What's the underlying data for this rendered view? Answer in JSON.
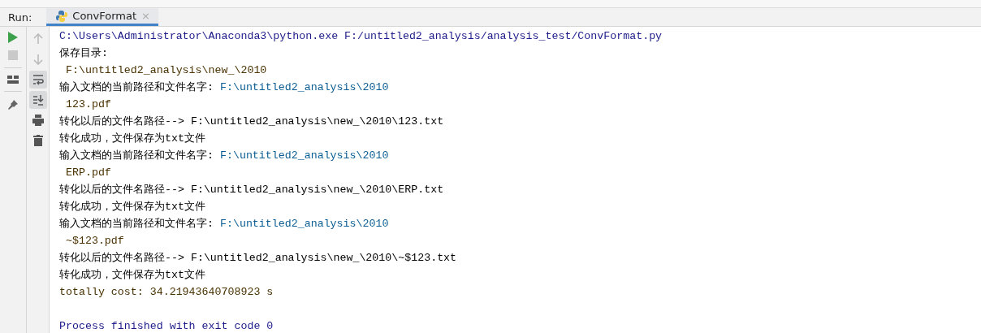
{
  "run_bar": {
    "label": "Run:",
    "tabs": [
      {
        "title": "ConvFormat",
        "selected": true,
        "close": "×"
      }
    ]
  },
  "left_toolbar": [
    {
      "kind": "run"
    },
    {
      "kind": "stop",
      "disabled": true
    },
    {
      "kind": "sep"
    },
    {
      "kind": "layout"
    },
    {
      "kind": "sep"
    },
    {
      "kind": "pin"
    }
  ],
  "console_toolbar": [
    {
      "kind": "up",
      "on": false
    },
    {
      "kind": "down",
      "on": false
    },
    {
      "kind": "wrap",
      "on": true
    },
    {
      "kind": "scroll",
      "on": true
    },
    {
      "kind": "print",
      "on": false
    },
    {
      "kind": "trash",
      "on": false
    }
  ],
  "console_lines": [
    [
      {
        "kind": "system",
        "text": "C:\\Users\\Administrator\\Anaconda3\\python.exe F:/untitled2_analysis/analysis_test/ConvFormat.py"
      }
    ],
    [
      {
        "kind": "output",
        "text": "保存目录:"
      }
    ],
    [
      {
        "kind": "echo",
        "text": " F:\\untitled2_analysis\\new_\\2010"
      }
    ],
    [
      {
        "kind": "output",
        "text": "输入文档的当前路径和文件名字: "
      },
      {
        "kind": "input",
        "text": "F:\\untitled2_analysis\\2010"
      }
    ],
    [
      {
        "kind": "echo",
        "text": " 123.pdf"
      }
    ],
    [
      {
        "kind": "output",
        "text": "转化以后的文件名路径--> F:\\untitled2_analysis\\new_\\2010\\123.txt"
      }
    ],
    [
      {
        "kind": "output",
        "text": "转化成功，文件保存为txt文件"
      }
    ],
    [
      {
        "kind": "output",
        "text": "输入文档的当前路径和文件名字: "
      },
      {
        "kind": "input",
        "text": "F:\\untitled2_analysis\\2010"
      }
    ],
    [
      {
        "kind": "echo",
        "text": " ERP.pdf"
      }
    ],
    [
      {
        "kind": "output",
        "text": "转化以后的文件名路径--> F:\\untitled2_analysis\\new_\\2010\\ERP.txt"
      }
    ],
    [
      {
        "kind": "output",
        "text": "转化成功，文件保存为txt文件"
      }
    ],
    [
      {
        "kind": "output",
        "text": "输入文档的当前路径和文件名字: "
      },
      {
        "kind": "input",
        "text": "F:\\untitled2_analysis\\2010"
      }
    ],
    [
      {
        "kind": "echo",
        "text": " ~$123.pdf"
      }
    ],
    [
      {
        "kind": "output",
        "text": "转化以后的文件名路径--> F:\\untitled2_analysis\\new_\\2010\\~$123.txt"
      }
    ],
    [
      {
        "kind": "output",
        "text": "转化成功，文件保存为txt文件"
      }
    ],
    [
      {
        "kind": "echo",
        "text": "totally cost: 34.21943640708923 s"
      }
    ],
    {
      "blank_before": true,
      "segments": [
        {
          "kind": "system",
          "text": "Process finished with exit code 0"
        }
      ]
    }
  ]
}
